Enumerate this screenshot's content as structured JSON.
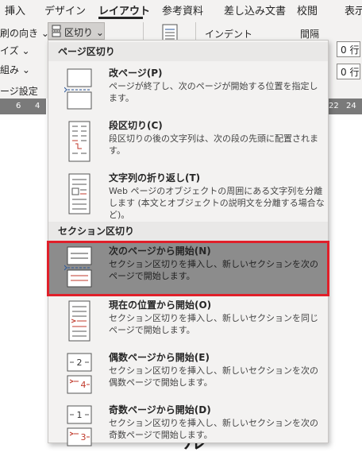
{
  "ribbon": {
    "tabs": [
      "挿入",
      "デザイン",
      "レイアウト",
      "参考資料",
      "差し込み文書",
      "校閲",
      "表示"
    ],
    "orientation_label": "印刷の向き",
    "orientation_visible": "刷の向き ⌄",
    "size_visible": "イズ ⌄",
    "columns_visible": "組み ⌄",
    "group_label_visible": "ージ設定",
    "breaks_label": "区切り ⌄",
    "indent_label": "インデント",
    "spacing_label": "間隔",
    "before_value": "0 行",
    "after_value": "0 行"
  },
  "ruler": {
    "left_numbers": [
      "6",
      "4"
    ],
    "right_numbers": [
      "22",
      "24"
    ]
  },
  "document": {
    "visible_text": "ル"
  },
  "menu": {
    "page_breaks_header": "ページ区切り",
    "section_breaks_header": "セクション区切り",
    "items": [
      {
        "title": "改ページ(P)",
        "desc": "ページが終了し、次のページが開始する位置を指定します。",
        "icon": "page-break-icon"
      },
      {
        "title": "段区切り(C)",
        "desc": "段区切りの後の文字列は、次の段の先頭に配置されます。",
        "icon": "column-break-icon"
      },
      {
        "title": "文字列の折り返し(T)",
        "desc": "Web ページのオブジェクトの周囲にある文字列を分離します (本文とオブジェクトの説明文を分離する場合など)。",
        "icon": "text-wrapping-icon"
      },
      {
        "title": "次のページから開始(N)",
        "desc": "セクション区切りを挿入し、新しいセクションを次のページで開始します。",
        "icon": "next-page-section-icon"
      },
      {
        "title": "現在の位置から開始(O)",
        "desc": "セクション区切りを挿入し、新しいセクションを同じページで開始します。",
        "icon": "continuous-section-icon"
      },
      {
        "title": "偶数ページから開始(E)",
        "desc": "セクション区切りを挿入し、新しいセクションを次の偶数ページで開始します。",
        "icon": "even-page-section-icon"
      },
      {
        "title": "奇数ページから開始(D)",
        "desc": "セクション区切りを挿入し、新しいセクションを次の奇数ページで開始します。",
        "icon": "odd-page-section-icon"
      }
    ]
  },
  "colors": {
    "highlight": "#8c8c8c",
    "highlight_border": "#e0202a",
    "accent_red": "#c0392b",
    "accent_blue": "#2b579a"
  }
}
